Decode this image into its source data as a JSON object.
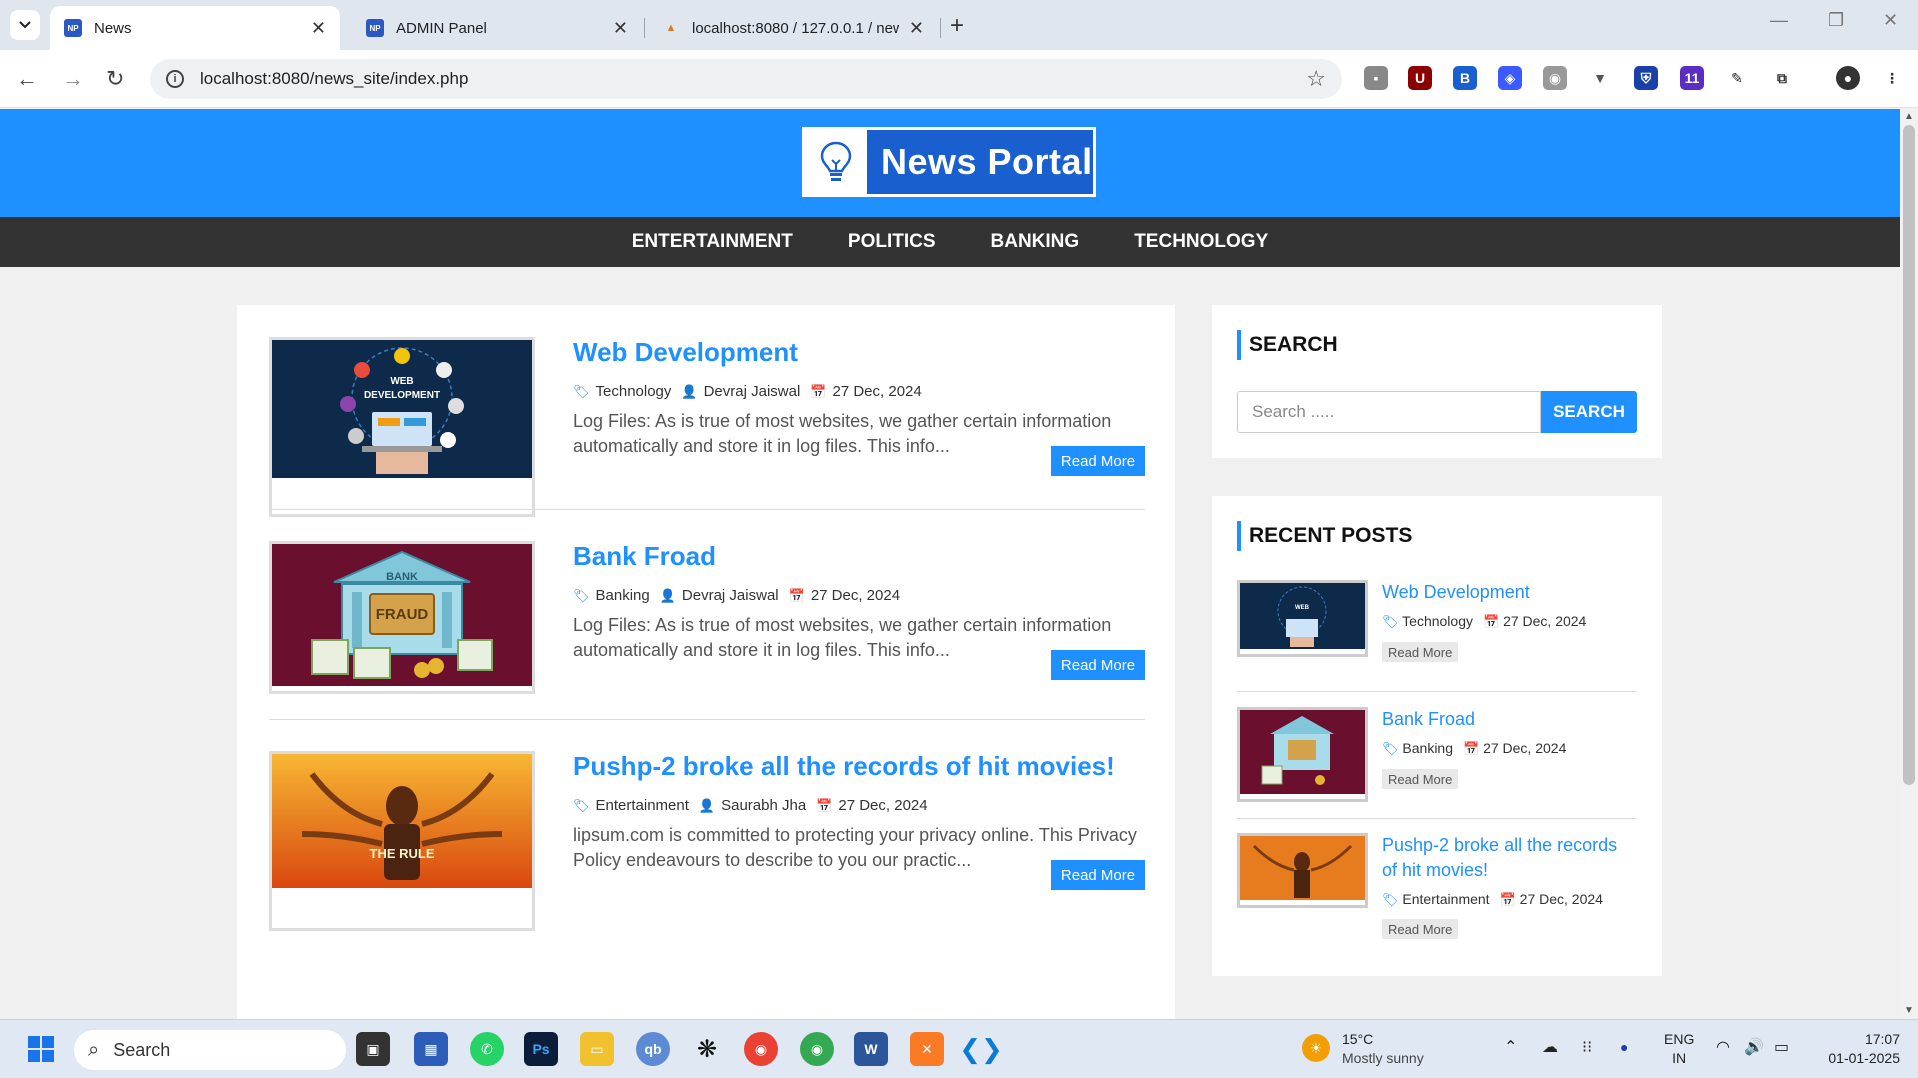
{
  "browser": {
    "tabs": [
      {
        "title": "News",
        "active": true
      },
      {
        "title": "ADMIN Panel",
        "active": false
      },
      {
        "title": "localhost:8080 / 127.0.0.1 / new",
        "active": false
      }
    ],
    "url": "localhost:8080/news_site/index.php"
  },
  "site": {
    "logo_text": "News Portal",
    "menu": [
      "ENTERTAINMENT",
      "POLITICS",
      "BANKING",
      "TECHNOLOGY"
    ]
  },
  "posts": [
    {
      "title": "Web Development",
      "category": "Technology",
      "author": "Devraj Jaiswal",
      "date": "27 Dec, 2024",
      "excerpt": "Log Files: As is true of most websites, we gather certain information automatically and store it in log files. This info...",
      "read_more": "Read More",
      "image_text": "WEB DEVELOPMENT"
    },
    {
      "title": "Bank Froad",
      "category": "Banking",
      "author": "Devraj Jaiswal",
      "date": "27 Dec, 2024",
      "excerpt": "Log Files: As is true of most websites, we gather certain information automatically and store it in log files. This info...",
      "read_more": "Read More",
      "image_text": "FRAUD",
      "image_text2": "BANK"
    },
    {
      "title": "Pushp-2 broke all the records of hit movies!",
      "category": "Entertainment",
      "author": "Saurabh Jha",
      "date": "27 Dec, 2024",
      "excerpt": "lipsum.com is committed to protecting your privacy online. This Privacy Policy endeavours to describe to you our practic...",
      "read_more": "Read More",
      "image_text": "THE RULE"
    }
  ],
  "sidebar": {
    "search_title": "SEARCH",
    "search_placeholder": "Search .....",
    "search_button": "SEARCH",
    "recent_title": "RECENT POSTS",
    "recent": [
      {
        "title": "Web Development",
        "category": "Technology",
        "date": "27 Dec, 2024",
        "read_more": "Read More"
      },
      {
        "title": "Bank Froad",
        "category": "Banking",
        "date": "27 Dec, 2024",
        "read_more": "Read More"
      },
      {
        "title": "Pushp-2 broke all the records of hit movies!",
        "category": "Entertainment",
        "date": "27 Dec, 2024",
        "read_more": "Read More"
      }
    ]
  },
  "taskbar": {
    "search_label": "Search",
    "weather_temp": "15°C",
    "weather_desc": "Mostly sunny",
    "lang": "ENG",
    "region": "IN",
    "time": "17:07",
    "date": "01-01-2025"
  }
}
